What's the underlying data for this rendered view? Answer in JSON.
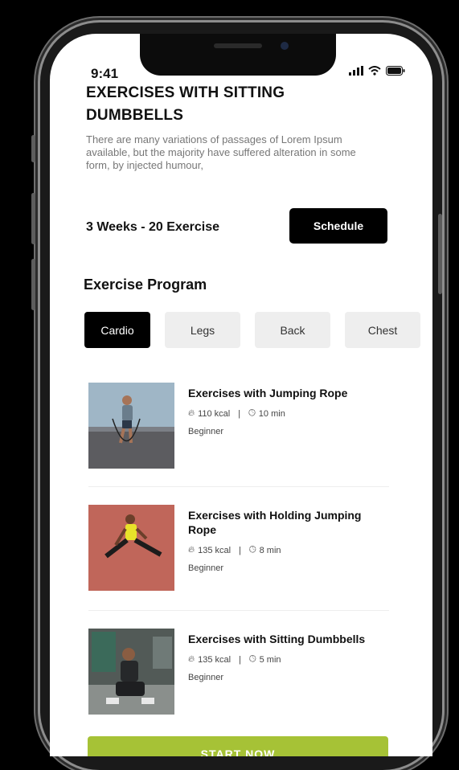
{
  "status_bar": {
    "time": "9:41"
  },
  "header": {
    "title": "EXERCISES WITH SITTING DUMBBELLS",
    "description": "There are many variations of passages of Lorem Ipsum available, but the majority have suffered alteration in some form, by injected humour,"
  },
  "plan": {
    "summary": "3 Weeks - 20 Exercise",
    "schedule_label": "Schedule"
  },
  "program": {
    "heading": "Exercise Program",
    "tabs": [
      {
        "label": "Cardio"
      },
      {
        "label": "Legs"
      },
      {
        "label": "Back"
      },
      {
        "label": "Chest"
      }
    ]
  },
  "exercises": [
    {
      "name": "Exercises with Jumping Rope",
      "kcal": "110 kcal",
      "sep": "|",
      "duration": "10 min",
      "level": "Beginner"
    },
    {
      "name": "Exercises with Holding Jumping Rope",
      "kcal": "135 kcal",
      "sep": "|",
      "duration": "8 min",
      "level": "Beginner"
    },
    {
      "name": "Exercises with Sitting Dumbbells",
      "kcal": "135 kcal",
      "sep": "|",
      "duration": "5 min",
      "level": "Beginner"
    }
  ],
  "cta": {
    "label": "START NOW"
  },
  "colors": {
    "accent": "#a6c236",
    "dark": "#000000",
    "tab_bg": "#eeeeee"
  }
}
